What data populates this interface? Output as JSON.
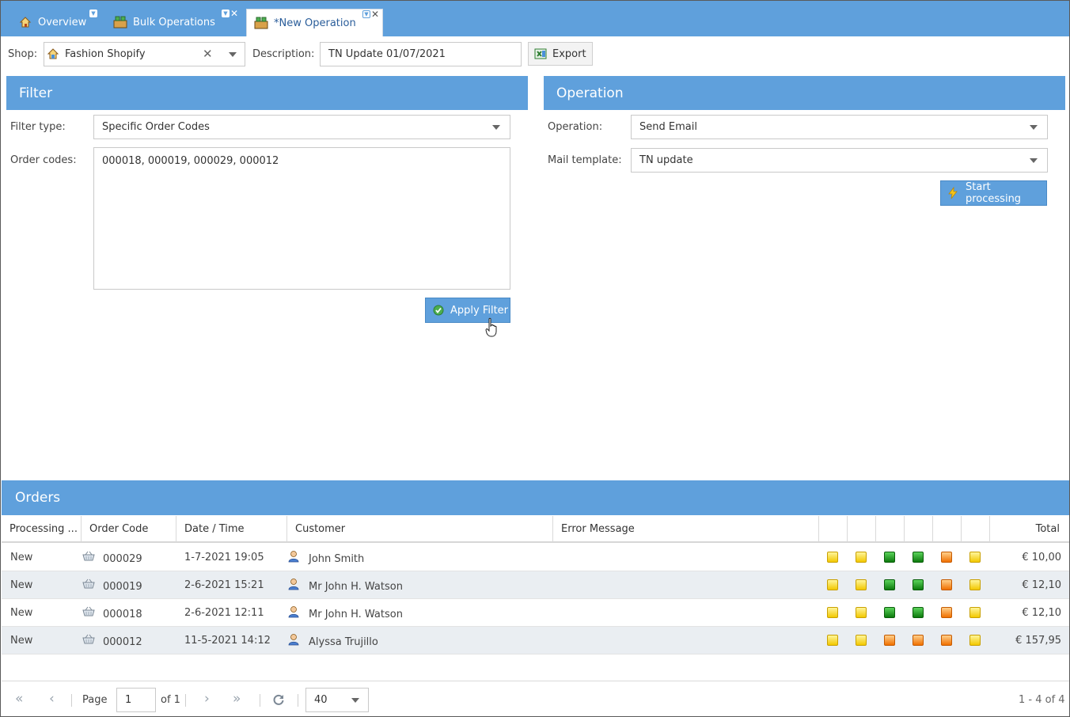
{
  "tabs": [
    {
      "label": "Overview",
      "icon": "home-icon"
    },
    {
      "label": "Bulk Operations",
      "icon": "boxes-icon"
    },
    {
      "label": "*New Operation",
      "icon": "boxes-icon"
    }
  ],
  "toolbar": {
    "shop_label": "Shop:",
    "shop_value": "Fashion Shopify",
    "description_label": "Description:",
    "description_value": "TN Update 01/07/2021",
    "export_label": "Export"
  },
  "filter": {
    "title": "Filter",
    "type_label": "Filter type:",
    "type_value": "Specific Order Codes",
    "codes_label": "Order codes:",
    "codes_value": "000018, 000019, 000029, 000012",
    "apply_label": "Apply Filter"
  },
  "operation": {
    "title": "Operation",
    "operation_label": "Operation:",
    "operation_value": "Send Email",
    "template_label": "Mail template:",
    "template_value": "TN update",
    "start_label": "Start processing"
  },
  "orders": {
    "title": "Orders",
    "columns": [
      "Processing ...",
      "Order Code",
      "Date / Time",
      "Customer",
      "Error Message",
      "Total"
    ],
    "rows": [
      {
        "status": "New",
        "code": "000029",
        "datetime": "1-7-2021 19:05",
        "customer": "John Smith",
        "error": "",
        "indicators": [
          "yellow",
          "yellow",
          "green",
          "green",
          "orange",
          "yellow"
        ],
        "total": "€ 10,00"
      },
      {
        "status": "New",
        "code": "000019",
        "datetime": "2-6-2021 15:21",
        "customer": "Mr John H. Watson",
        "error": "",
        "indicators": [
          "yellow",
          "yellow",
          "green",
          "green",
          "orange",
          "yellow"
        ],
        "total": "€ 12,10"
      },
      {
        "status": "New",
        "code": "000018",
        "datetime": "2-6-2021 12:11",
        "customer": "Mr John H. Watson",
        "error": "",
        "indicators": [
          "yellow",
          "yellow",
          "green",
          "green",
          "orange",
          "yellow"
        ],
        "total": "€ 12,10"
      },
      {
        "status": "New",
        "code": "000012",
        "datetime": "11-5-2021 14:12",
        "customer": "Alyssa Trujillo",
        "error": "",
        "indicators": [
          "yellow",
          "yellow",
          "orange",
          "orange",
          "orange",
          "yellow"
        ],
        "total": "€ 157,95"
      }
    ]
  },
  "pager": {
    "page_label": "Page",
    "page_value": "1",
    "of_label": "of 1",
    "page_size": "40",
    "summary": "1 - 4 of 4"
  },
  "colors": {
    "header_blue": "#5fa0dc",
    "indicator_yellow": "#f3c800",
    "indicator_green": "#0d7a0d",
    "indicator_orange": "#f07000"
  }
}
